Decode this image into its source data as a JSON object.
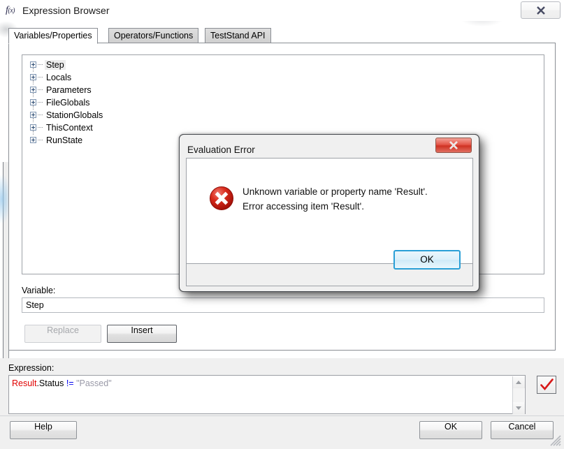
{
  "window": {
    "title": "Expression Browser",
    "icon": "fx-function-icon",
    "close_button_icon": "close-x-icon"
  },
  "tabs": [
    {
      "label": "Variables/Properties",
      "active": true
    },
    {
      "label": "Operators/Functions",
      "active": false
    },
    {
      "label": "TestStand API",
      "active": false
    }
  ],
  "tree": {
    "items": [
      {
        "label": "Step",
        "selected": true,
        "expander": "plus-icon"
      },
      {
        "label": "Locals",
        "selected": false,
        "expander": "plus-icon"
      },
      {
        "label": "Parameters",
        "selected": false,
        "expander": "plus-icon"
      },
      {
        "label": "FileGlobals",
        "selected": false,
        "expander": "plus-icon"
      },
      {
        "label": "StationGlobals",
        "selected": false,
        "expander": "plus-icon"
      },
      {
        "label": "ThisContext",
        "selected": false,
        "expander": "plus-icon"
      },
      {
        "label": "RunState",
        "selected": false,
        "expander": "plus-icon"
      }
    ]
  },
  "variable": {
    "label": "Variable:",
    "value": "Step",
    "placeholder": ""
  },
  "actions": {
    "replace_label": "Replace",
    "replace_enabled": false,
    "insert_label": "Insert",
    "insert_enabled": true
  },
  "expression": {
    "label": "Expression:",
    "tokens": [
      {
        "text": "Result",
        "kind": "variable",
        "color": "#e00000"
      },
      {
        "text": ".Status ",
        "kind": "plain",
        "color": "#000000"
      },
      {
        "text": "!=",
        "kind": "operator",
        "color": "#0000ee"
      },
      {
        "text": " \"Passed\"",
        "kind": "string",
        "color": "#9a9aa8"
      }
    ],
    "full_text": "Result.Status != \"Passed\"",
    "scroll_up_icon": "triangle-up-icon",
    "scroll_down_icon": "triangle-down-icon",
    "evaluate_button_icon": "red-checkmark-icon"
  },
  "footer": {
    "help_label": "Help",
    "ok_label": "OK",
    "cancel_label": "Cancel",
    "resize_grip_icon": "resize-grip-icon"
  },
  "error_dialog": {
    "title": "Evaluation Error",
    "close_button_icon": "close-x-icon",
    "icon": "error-circle-x-icon",
    "message_line1": "Unknown variable or property name 'Result'.",
    "message_line2": "Error accessing item 'Result'.",
    "ok_label": "OK",
    "accent_color": "#2a9fd6",
    "titlebar_close_color": "#cf3223"
  }
}
